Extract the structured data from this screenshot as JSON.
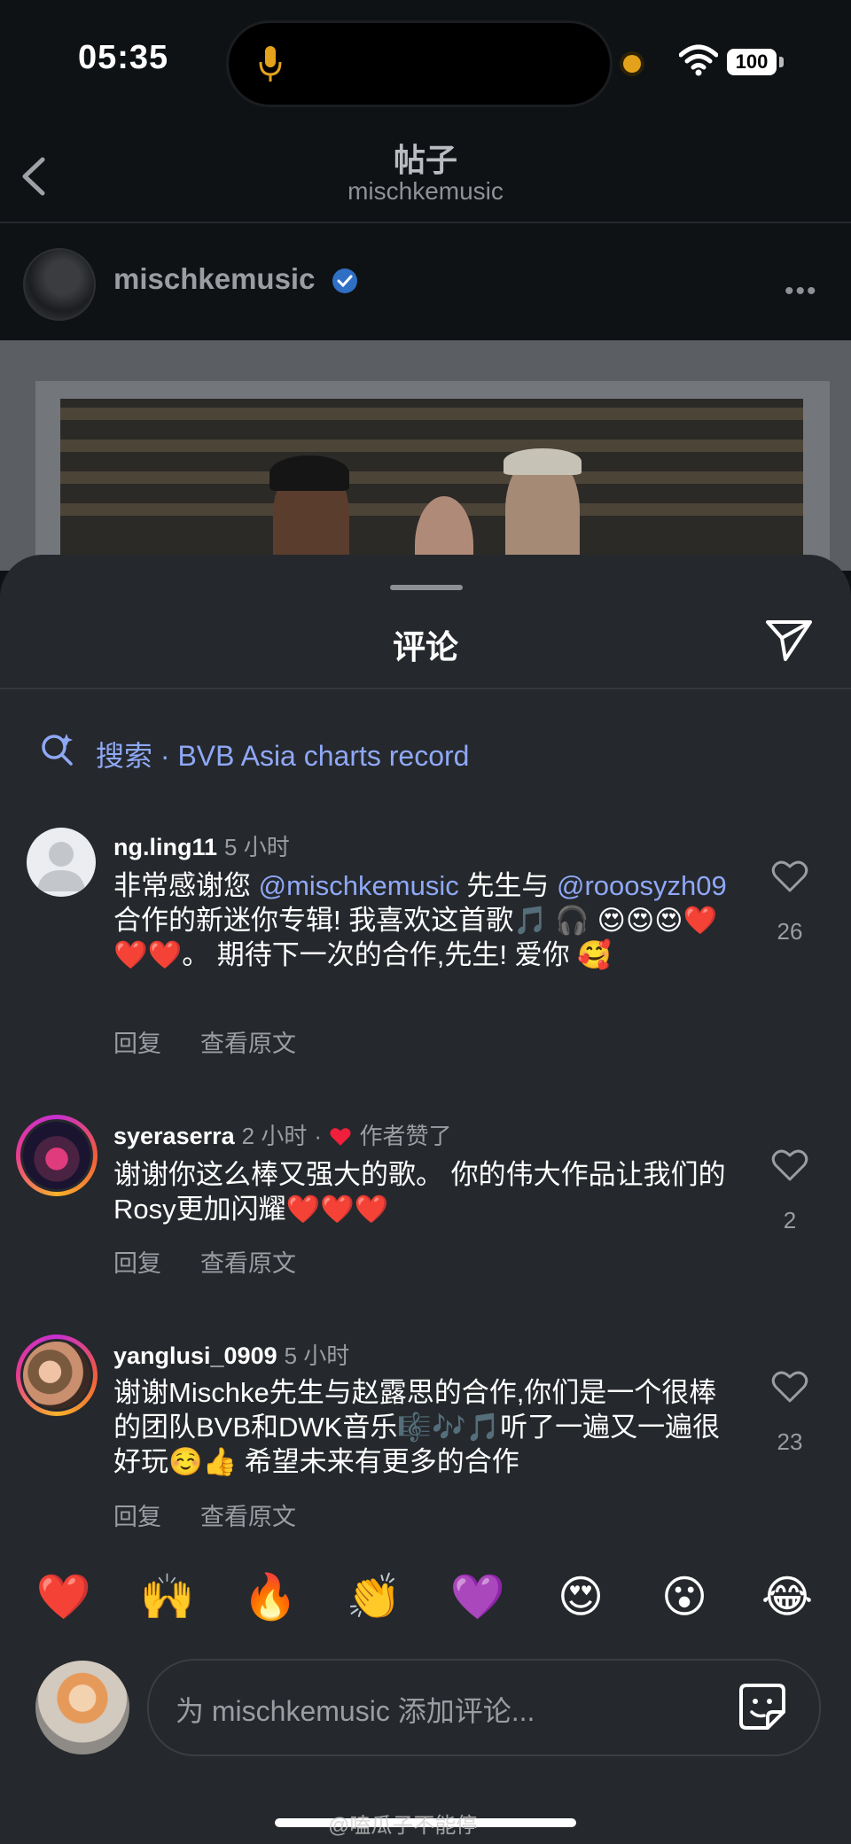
{
  "status": {
    "time": "05:35",
    "battery": "100"
  },
  "post": {
    "title": "帖子",
    "subtitle": "mischkemusic",
    "author": "mischkemusic"
  },
  "sheet": {
    "title": "评论"
  },
  "search": {
    "label": "搜索 · BVB Asia charts record"
  },
  "comments": [
    {
      "username": "ng.ling11",
      "time": "5 小时",
      "body_pre": "非常感谢您 ",
      "mention1": "@mischkemusic",
      "body_mid": " 先生与 ",
      "mention2": "@rooosyzh09",
      "body_post": " 合作的新迷你专辑! 我喜欢这首歌🎵 🎧 😍😍😍❤️❤️❤️。 期待下一次的合作,先生! 爱你 🥰",
      "reply": "回复",
      "translate": "查看原文",
      "likes": "26"
    },
    {
      "username": "syeraserra",
      "time": "2 小时",
      "liked_by_author": "作者赞了",
      "body": "谢谢你这么棒又强大的歌。 你的伟大作品让我们的Rosy更加闪耀❤️❤️❤️",
      "reply": "回复",
      "translate": "查看原文",
      "likes": "2"
    },
    {
      "username": "yanglusi_0909",
      "time": "5 小时",
      "body": "谢谢Mischke先生与赵露思的合作,你们是一个很棒的团队BVB和DWK音乐🎼🎶🎵听了一遍又一遍很好玩☺️👍 希望未来有更多的合作",
      "reply": "回复",
      "translate": "查看原文",
      "likes": "23"
    }
  ],
  "emoji_bar": [
    "❤️",
    "🙌",
    "🔥",
    "👏",
    "💜",
    "😍",
    "😮",
    "😂"
  ],
  "input": {
    "placeholder": "为 mischkemusic 添加评论..."
  },
  "watermark": "@嗑瓜子不能停"
}
